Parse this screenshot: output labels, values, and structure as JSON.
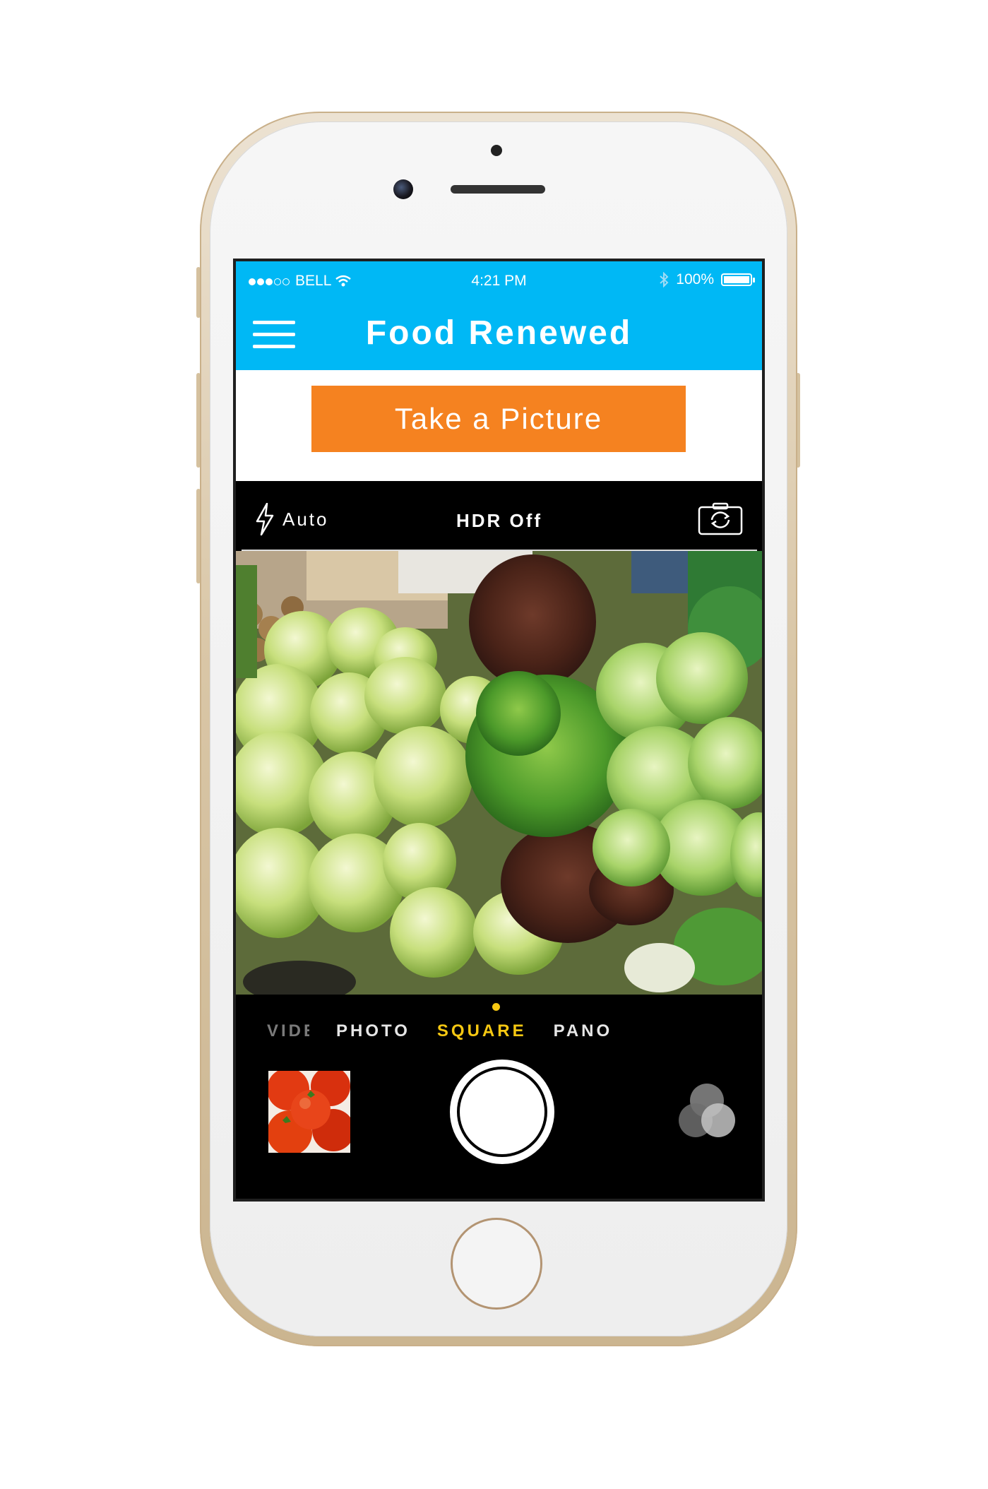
{
  "status_bar": {
    "carrier": "BELL",
    "time": "4:21 PM",
    "battery_percent": "100%",
    "battery_level": 1.0,
    "signal_bars_filled": 3,
    "signal_bars_total": 5
  },
  "header": {
    "title": "Food Renewed",
    "menu_icon": "hamburger-menu-icon",
    "color": "#00b8f5"
  },
  "action": {
    "take_picture_label": "Take a Picture",
    "color": "#f58220"
  },
  "camera": {
    "flash_label": "Auto",
    "hdr_label": "HDR Off",
    "modes": [
      "VIDEO",
      "PHOTO",
      "SQUARE",
      "PANO"
    ],
    "selected_mode": "SQUARE",
    "accent_color": "#f6c812",
    "viewfinder_subject": "lettuce-vegetables",
    "thumbnail_subject": "tomatoes"
  }
}
